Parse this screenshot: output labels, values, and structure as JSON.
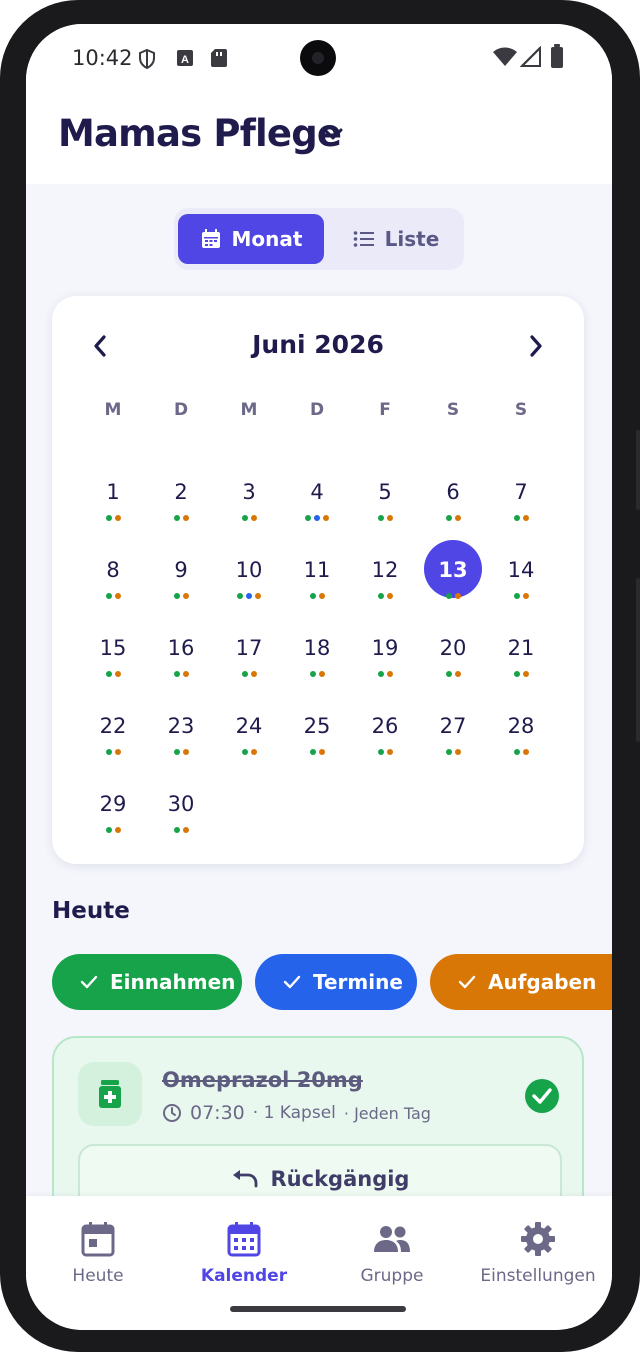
{
  "status_bar": {
    "time": "10:42",
    "icons": [
      "shield-icon",
      "a-notification-icon",
      "sd-card-icon",
      "wifi-icon",
      "signal-icon",
      "battery-icon"
    ]
  },
  "header": {
    "title": "Mamas Pflege",
    "icon": "chevron-down-icon"
  },
  "view_toggle": {
    "month_label": "Monat",
    "list_label": "Liste",
    "selected": "Monat",
    "accent_color": "#4f46e5"
  },
  "calendar": {
    "title": "Juni 2026",
    "weekdays": [
      "M",
      "D",
      "M",
      "D",
      "F",
      "S",
      "S"
    ],
    "today": "13",
    "days": [
      {
        "n": "1",
        "dots": [
          "g",
          "o"
        ]
      },
      {
        "n": "2",
        "dots": [
          "g",
          "o"
        ]
      },
      {
        "n": "3",
        "dots": [
          "g",
          "o"
        ]
      },
      {
        "n": "4",
        "dots": [
          "g",
          "b",
          "o"
        ]
      },
      {
        "n": "5",
        "dots": [
          "g",
          "o"
        ]
      },
      {
        "n": "6",
        "dots": [
          "g",
          "o"
        ]
      },
      {
        "n": "7",
        "dots": [
          "g",
          "o"
        ]
      },
      {
        "n": "8",
        "dots": [
          "g",
          "o"
        ]
      },
      {
        "n": "9",
        "dots": [
          "g",
          "o"
        ]
      },
      {
        "n": "10",
        "dots": [
          "g",
          "b",
          "o"
        ]
      },
      {
        "n": "11",
        "dots": [
          "g",
          "o"
        ]
      },
      {
        "n": "12",
        "dots": [
          "g",
          "o"
        ]
      },
      {
        "n": "13",
        "dots": [
          "g",
          "o"
        ]
      },
      {
        "n": "14",
        "dots": [
          "g",
          "o"
        ]
      },
      {
        "n": "15",
        "dots": [
          "g",
          "o"
        ]
      },
      {
        "n": "16",
        "dots": [
          "g",
          "o"
        ]
      },
      {
        "n": "17",
        "dots": [
          "g",
          "o"
        ]
      },
      {
        "n": "18",
        "dots": [
          "g",
          "o"
        ]
      },
      {
        "n": "19",
        "dots": [
          "g",
          "o"
        ]
      },
      {
        "n": "20",
        "dots": [
          "g",
          "o"
        ]
      },
      {
        "n": "21",
        "dots": [
          "g",
          "o"
        ]
      },
      {
        "n": "22",
        "dots": [
          "g",
          "o"
        ]
      },
      {
        "n": "23",
        "dots": [
          "g",
          "o"
        ]
      },
      {
        "n": "24",
        "dots": [
          "g",
          "o"
        ]
      },
      {
        "n": "25",
        "dots": [
          "g",
          "o"
        ]
      },
      {
        "n": "26",
        "dots": [
          "g",
          "o"
        ]
      },
      {
        "n": "27",
        "dots": [
          "g",
          "o"
        ]
      },
      {
        "n": "28",
        "dots": [
          "g",
          "o"
        ]
      },
      {
        "n": "29",
        "dots": [
          "g",
          "o"
        ]
      },
      {
        "n": "30",
        "dots": [
          "g",
          "o"
        ]
      }
    ],
    "dot_colors": {
      "g": "#16a34a",
      "o": "#d97706",
      "b": "#2563eb"
    }
  },
  "today_section": {
    "title": "Heute",
    "chips": [
      {
        "label": "Einnahmen",
        "color": "#16a34a"
      },
      {
        "label": "Termine",
        "color": "#2563eb"
      },
      {
        "label": "Aufgaben",
        "color": "#d97706"
      }
    ],
    "medication": {
      "name": "Omeprazol 20mg",
      "time": "07:30",
      "amount": "· 1 Kapsel",
      "frequency": "· Jeden Tag",
      "undo_label": "Rückgängig",
      "done": true
    }
  },
  "bottom_nav": {
    "items": [
      {
        "label": "Heute",
        "icon": "calendar-day-icon"
      },
      {
        "label": "Kalender",
        "icon": "calendar-month-icon",
        "active": true
      },
      {
        "label": "Gruppe",
        "icon": "group-icon"
      },
      {
        "label": "Einstellungen",
        "icon": "gear-icon"
      }
    ]
  }
}
